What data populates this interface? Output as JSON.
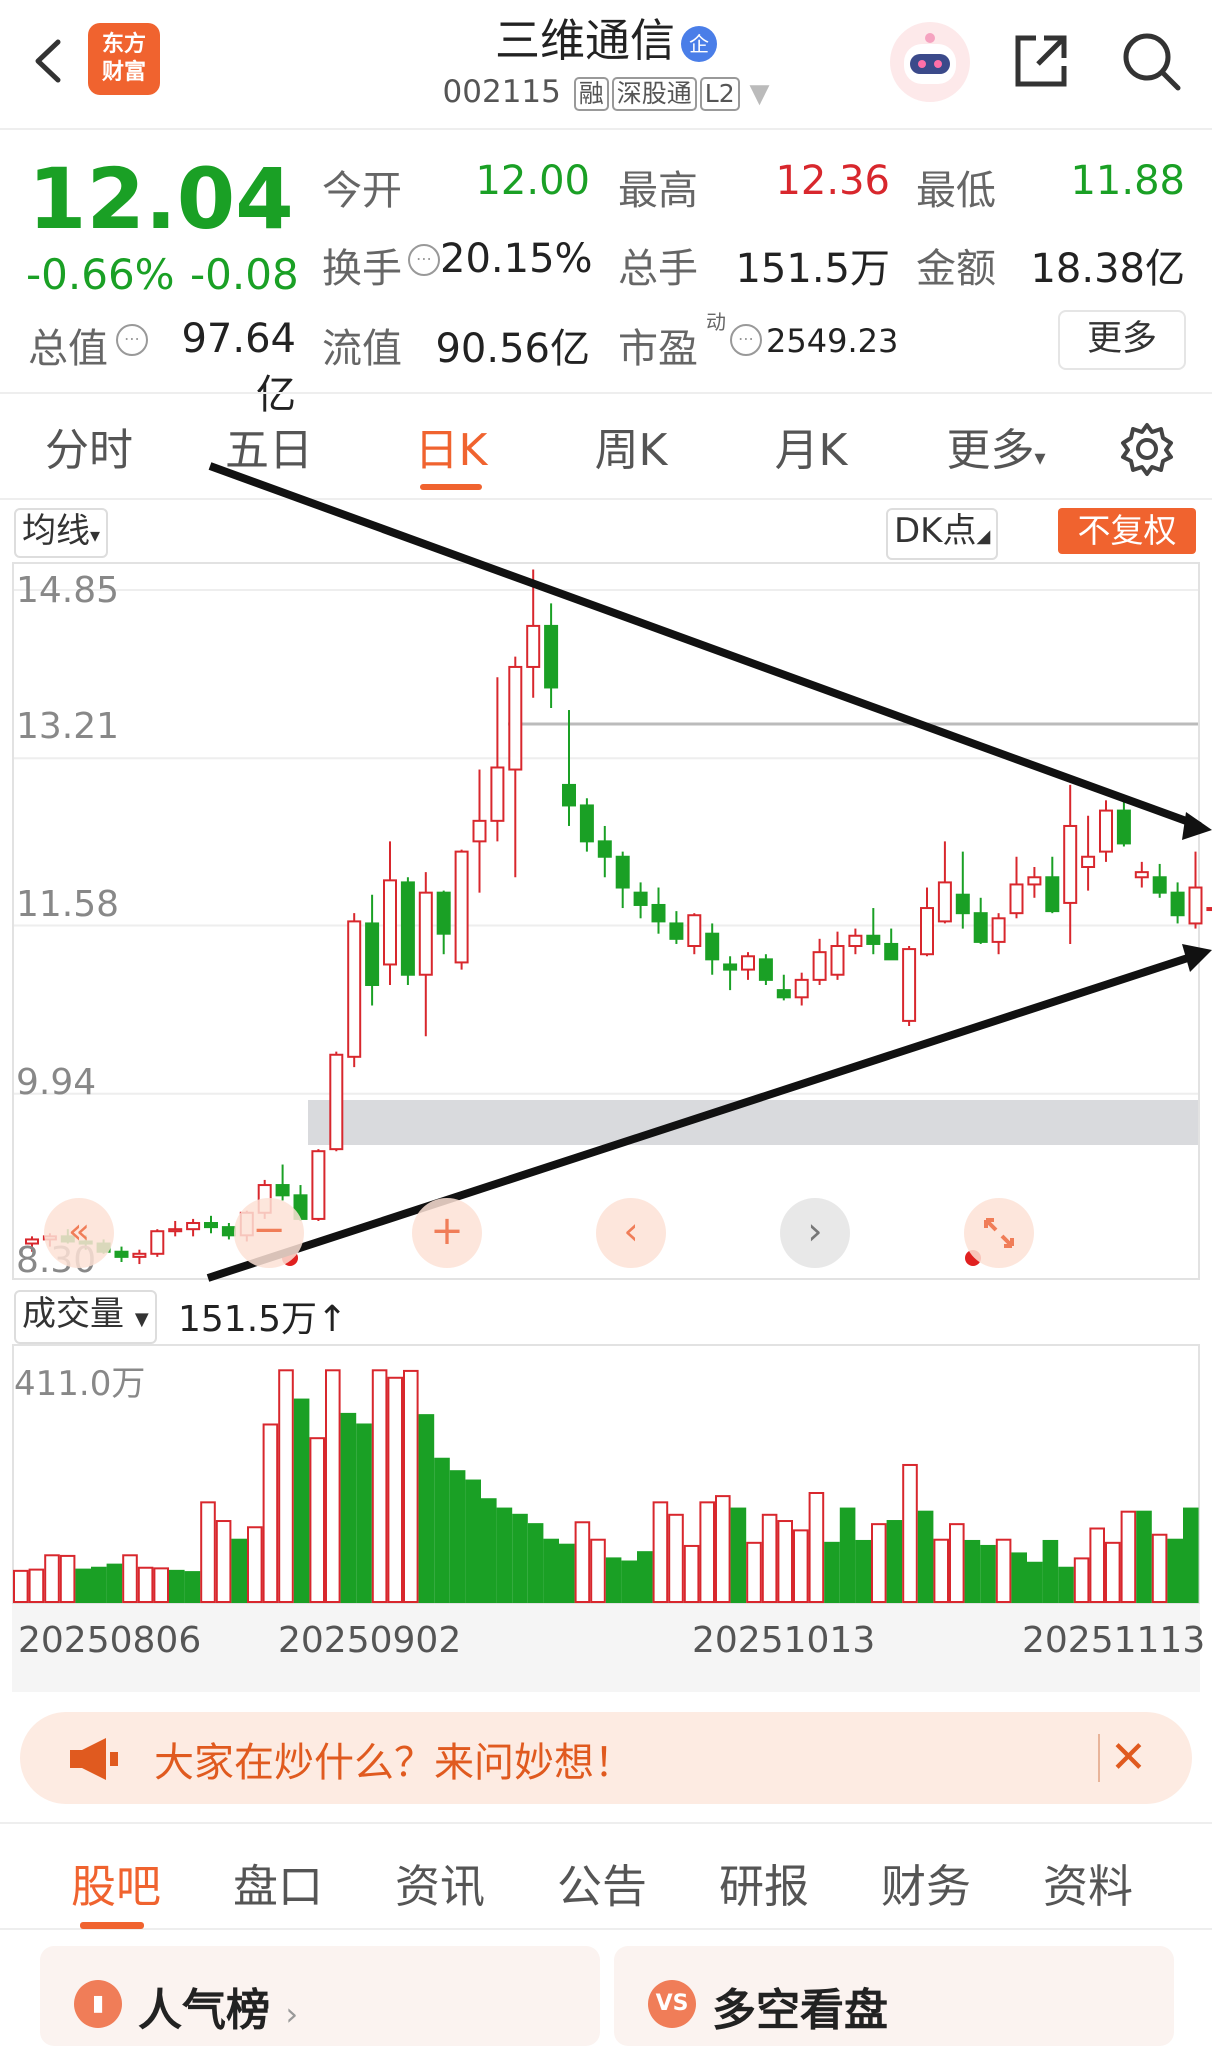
{
  "header": {
    "logo_text": "东方财富",
    "stock_name": "三维通信",
    "enterprise_badge": "企",
    "stock_code": "002115",
    "tags": [
      "融",
      "深股通",
      "L2"
    ]
  },
  "quote": {
    "price": "12.04",
    "change_pct": "-0.66%",
    "change": "-0.08",
    "open_label": "今开",
    "open": "12.00",
    "high_label": "最高",
    "high": "12.36",
    "low_label": "最低",
    "low": "11.88",
    "turnover_label": "换手",
    "turnover": "20.15%",
    "volume_label": "总手",
    "volume": "151.5万",
    "amount_label": "金额",
    "amount": "18.38亿",
    "mktcap_label": "总值",
    "mktcap": "97.64亿",
    "float_label": "流值",
    "float_cap": "90.56亿",
    "pe_label": "市盈",
    "pe_sup": "动",
    "pe": "2549.23",
    "more_label": "更多"
  },
  "chart_tabs": [
    "分时",
    "五日",
    "日K",
    "周K",
    "月K",
    "更多"
  ],
  "chart_tab_active": "日K",
  "chart_toolbar": {
    "ma_label": "均线",
    "dk_label": "DK点",
    "adjust_label": "不复权"
  },
  "y_labels": [
    "14.85",
    "13.21",
    "11.58",
    "9.94",
    "8.30"
  ],
  "volume_panel": {
    "label": "成交量",
    "value": "151.5万",
    "max_label": "411.0万"
  },
  "x_labels": [
    "20250806",
    "20250902",
    "20251013",
    "20251113"
  ],
  "banner": {
    "text": "大家在炒什么？来问妙想！"
  },
  "bottom_tabs": [
    "股吧",
    "盘口",
    "资讯",
    "公告",
    "研报",
    "财务",
    "资料"
  ],
  "bottom_tab_active": "股吧",
  "cards": [
    {
      "icon": "popularity-chart-icon",
      "label": "人气榜"
    },
    {
      "icon": "vs-icon",
      "label": "多空看盘"
    }
  ],
  "colors": {
    "up": "#d8272d",
    "down": "#1aa025",
    "accent": "#f0632f"
  },
  "chart_data": {
    "type": "candlestick",
    "ylim": [
      8.3,
      14.85
    ],
    "candles": [
      [
        8.48,
        8.55,
        8.4,
        8.52
      ],
      [
        8.52,
        8.58,
        8.45,
        8.55
      ],
      [
        8.55,
        8.62,
        8.48,
        8.5
      ],
      [
        8.5,
        8.56,
        8.42,
        8.48
      ],
      [
        8.48,
        8.52,
        8.38,
        8.4
      ],
      [
        8.4,
        8.45,
        8.3,
        8.35
      ],
      [
        8.35,
        8.42,
        8.28,
        8.38
      ],
      [
        8.38,
        8.62,
        8.35,
        8.6
      ],
      [
        8.6,
        8.7,
        8.55,
        8.62
      ],
      [
        8.62,
        8.72,
        8.55,
        8.68
      ],
      [
        8.68,
        8.75,
        8.58,
        8.64
      ],
      [
        8.64,
        8.68,
        8.52,
        8.56
      ],
      [
        8.56,
        8.8,
        8.5,
        8.78
      ],
      [
        8.78,
        9.1,
        8.72,
        9.05
      ],
      [
        9.05,
        9.25,
        8.9,
        8.95
      ],
      [
        8.95,
        9.05,
        8.7,
        8.72
      ],
      [
        8.72,
        9.4,
        8.7,
        9.38
      ],
      [
        9.4,
        10.35,
        9.38,
        10.32
      ],
      [
        10.3,
        11.7,
        10.2,
        11.62
      ],
      [
        11.6,
        11.88,
        10.8,
        11.0
      ],
      [
        11.2,
        12.4,
        11.0,
        12.02
      ],
      [
        12.0,
        12.05,
        11.0,
        11.1
      ],
      [
        11.1,
        12.1,
        10.5,
        11.9
      ],
      [
        11.9,
        11.92,
        11.3,
        11.5
      ],
      [
        11.22,
        12.32,
        11.15,
        12.3
      ],
      [
        12.4,
        13.1,
        11.9,
        12.6
      ],
      [
        12.6,
        14.0,
        12.4,
        13.12
      ],
      [
        13.1,
        14.2,
        12.05,
        14.1
      ],
      [
        14.1,
        15.05,
        13.8,
        14.5
      ],
      [
        14.5,
        14.72,
        13.7,
        13.9
      ],
      [
        12.95,
        13.68,
        12.55,
        12.75
      ],
      [
        12.75,
        12.82,
        12.3,
        12.4
      ],
      [
        12.4,
        12.55,
        12.05,
        12.25
      ],
      [
        12.25,
        12.3,
        11.75,
        11.95
      ],
      [
        11.9,
        12.0,
        11.65,
        11.78
      ],
      [
        11.78,
        11.95,
        11.5,
        11.62
      ],
      [
        11.6,
        11.72,
        11.4,
        11.45
      ],
      [
        11.38,
        11.7,
        11.3,
        11.68
      ],
      [
        11.5,
        11.6,
        11.1,
        11.25
      ],
      [
        11.2,
        11.28,
        10.95,
        11.15
      ],
      [
        11.15,
        11.32,
        11.05,
        11.28
      ],
      [
        11.25,
        11.3,
        11.0,
        11.05
      ],
      [
        10.95,
        11.1,
        10.85,
        10.88
      ],
      [
        10.88,
        11.12,
        10.8,
        11.05
      ],
      [
        11.05,
        11.45,
        11.0,
        11.32
      ],
      [
        11.1,
        11.52,
        11.05,
        11.38
      ],
      [
        11.38,
        11.55,
        11.3,
        11.48
      ],
      [
        11.48,
        11.75,
        11.3,
        11.4
      ],
      [
        11.4,
        11.55,
        11.25,
        11.25
      ],
      [
        10.65,
        11.38,
        10.6,
        11.35
      ],
      [
        11.3,
        11.95,
        11.28,
        11.75
      ],
      [
        11.62,
        12.4,
        11.6,
        12.0
      ],
      [
        11.88,
        12.3,
        11.55,
        11.7
      ],
      [
        11.7,
        11.85,
        11.4,
        11.42
      ],
      [
        11.42,
        11.7,
        11.3,
        11.65
      ],
      [
        11.7,
        12.25,
        11.65,
        11.98
      ],
      [
        11.98,
        12.15,
        11.85,
        12.05
      ],
      [
        12.05,
        12.25,
        11.7,
        11.72
      ],
      [
        11.8,
        12.95,
        11.4,
        12.55
      ],
      [
        12.15,
        12.65,
        11.92,
        12.25
      ],
      [
        12.3,
        12.8,
        12.2,
        12.7
      ],
      [
        12.7,
        12.8,
        12.35,
        12.38
      ],
      [
        12.05,
        12.2,
        11.95,
        12.1
      ],
      [
        12.05,
        12.18,
        11.85,
        11.9
      ],
      [
        11.9,
        12.0,
        11.6,
        11.68
      ],
      [
        11.6,
        12.3,
        11.55,
        11.95
      ],
      [
        11.75,
        11.82,
        11.65,
        11.75
      ],
      [
        11.75,
        11.88,
        11.55,
        11.6
      ],
      [
        11.6,
        11.82,
        11.45,
        11.78
      ],
      [
        11.82,
        11.92,
        11.5,
        11.55
      ],
      [
        11.55,
        11.65,
        11.28,
        11.42
      ],
      [
        11.3,
        11.7,
        11.28,
        11.55
      ],
      [
        11.38,
        11.65,
        11.2,
        11.52
      ],
      [
        11.55,
        11.7,
        11.35,
        11.45
      ],
      [
        11.45,
        11.8,
        11.42,
        11.95
      ],
      [
        11.95,
        12.0,
        11.6,
        11.88
      ],
      [
        12.12,
        12.5,
        11.8,
        12.04
      ]
    ],
    "volumes": [
      [
        0.5,
        1
      ],
      [
        0.52,
        1
      ],
      [
        0.75,
        1
      ],
      [
        0.74,
        1
      ],
      [
        0.52,
        0
      ],
      [
        0.55,
        0
      ],
      [
        0.6,
        0
      ],
      [
        0.75,
        1
      ],
      [
        0.55,
        1
      ],
      [
        0.54,
        1
      ],
      [
        0.5,
        0
      ],
      [
        0.48,
        0
      ],
      [
        1.6,
        1
      ],
      [
        1.3,
        1
      ],
      [
        1.0,
        0
      ],
      [
        1.2,
        1
      ],
      [
        2.85,
        1
      ],
      [
        3.72,
        1
      ],
      [
        3.25,
        0
      ],
      [
        2.63,
        1
      ],
      [
        3.72,
        1
      ],
      [
        3.02,
        0
      ],
      [
        2.85,
        0
      ],
      [
        3.72,
        1
      ],
      [
        3.6,
        1
      ],
      [
        3.71,
        1
      ],
      [
        3.0,
        0
      ],
      [
        2.3,
        0
      ],
      [
        2.1,
        0
      ],
      [
        1.95,
        0
      ],
      [
        1.65,
        0
      ],
      [
        1.5,
        0
      ],
      [
        1.4,
        0
      ],
      [
        1.25,
        0
      ],
      [
        1.0,
        0
      ],
      [
        0.92,
        0
      ],
      [
        1.28,
        1
      ],
      [
        1.0,
        1
      ],
      [
        0.7,
        0
      ],
      [
        0.65,
        0
      ],
      [
        0.8,
        0
      ],
      [
        1.6,
        1
      ],
      [
        1.4,
        1
      ],
      [
        0.9,
        1
      ],
      [
        1.6,
        1
      ],
      [
        1.7,
        1
      ],
      [
        1.5,
        0
      ],
      [
        0.95,
        1
      ],
      [
        1.4,
        1
      ],
      [
        1.3,
        1
      ],
      [
        1.15,
        1
      ],
      [
        1.75,
        1
      ],
      [
        0.95,
        0
      ],
      [
        1.5,
        0
      ],
      [
        0.98,
        0
      ],
      [
        1.25,
        1
      ],
      [
        1.3,
        0
      ],
      [
        2.2,
        1
      ],
      [
        1.45,
        0
      ],
      [
        1.0,
        1
      ],
      [
        1.25,
        1
      ],
      [
        0.98,
        0
      ],
      [
        0.9,
        0
      ],
      [
        1.0,
        1
      ],
      [
        0.78,
        0
      ],
      [
        0.63,
        0
      ],
      [
        0.98,
        0
      ],
      [
        0.55,
        0
      ],
      [
        0.7,
        1
      ],
      [
        1.18,
        1
      ],
      [
        0.95,
        1
      ],
      [
        1.45,
        1
      ],
      [
        1.45,
        0
      ],
      [
        1.08,
        1
      ],
      [
        1.0,
        0
      ],
      [
        1.5,
        0
      ]
    ]
  }
}
